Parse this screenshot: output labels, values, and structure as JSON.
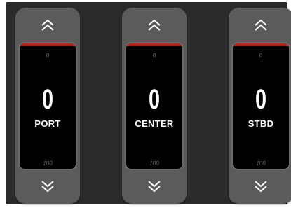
{
  "colors": {
    "panel_bg": "#2a2a2a",
    "control_bg": "#5b5b5b",
    "display_bg": "#000000",
    "redline": "#c8321e",
    "text": "#ffffff",
    "scale_text": "#6e6e6e"
  },
  "icons": {
    "up": "double-chevron-up-icon",
    "down": "double-chevron-down-icon"
  },
  "controls": [
    {
      "id": "port",
      "label": "PORT",
      "value": "0",
      "scale_min": "0",
      "scale_max": "100",
      "level": 0
    },
    {
      "id": "center",
      "label": "CENTER",
      "value": "0",
      "scale_min": "0",
      "scale_max": "100",
      "level": 0
    },
    {
      "id": "stbd",
      "label": "STBD",
      "value": "0",
      "scale_min": "0",
      "scale_max": "100",
      "level": 0
    }
  ]
}
